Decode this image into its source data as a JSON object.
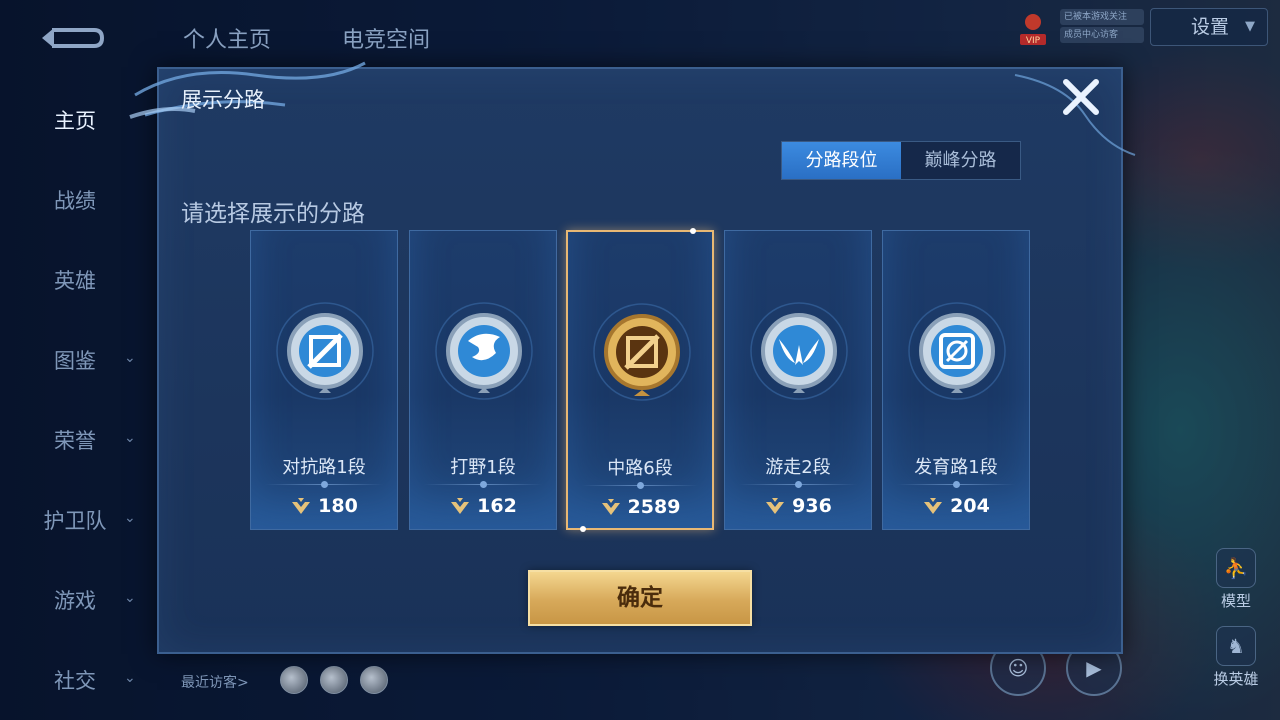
{
  "sidebar": {
    "items": [
      {
        "label": "主页",
        "has_chevron": false
      },
      {
        "label": "战绩",
        "has_chevron": false
      },
      {
        "label": "英雄",
        "has_chevron": false
      },
      {
        "label": "图鉴",
        "has_chevron": true
      },
      {
        "label": "荣誉",
        "has_chevron": true
      },
      {
        "label": "护卫队",
        "has_chevron": true
      },
      {
        "label": "游戏",
        "has_chevron": true
      },
      {
        "label": "社交",
        "has_chevron": true
      }
    ],
    "chevron_glyph": "⌄"
  },
  "top_tabs": [
    "个人主页",
    "电竞空间"
  ],
  "top_right": {
    "vip_label": "VIP",
    "badge_line1": "已被本游戏关注",
    "badge_line2": "成员中心访客",
    "settings_label": "设置"
  },
  "bottom": {
    "recent_visitors_label": "最近访客>",
    "model_label": "模型",
    "change_hero_label": "换英雄"
  },
  "modal": {
    "title": "展示分路",
    "close_glyph": "✕",
    "segments": [
      "分路段位",
      "巅峰分路"
    ],
    "active_segment": 0,
    "prompt": "请选择展示的分路",
    "cards": [
      {
        "lane": "对抗路1段",
        "score": "180",
        "selected": false,
        "icon": "sword-emblem-icon"
      },
      {
        "lane": "打野1段",
        "score": "162",
        "selected": false,
        "icon": "dragon-emblem-icon"
      },
      {
        "lane": "中路6段",
        "score": "2589",
        "selected": true,
        "icon": "slash-emblem-icon"
      },
      {
        "lane": "游走2段",
        "score": "936",
        "selected": false,
        "icon": "wing-emblem-icon"
      },
      {
        "lane": "发育路1段",
        "score": "204",
        "selected": false,
        "icon": "target-emblem-icon"
      }
    ],
    "confirm_label": "确定"
  },
  "colors": {
    "accent_blue": "#2f7bd6",
    "selected_border": "#e8b874",
    "gold_button": "#d7a95a"
  }
}
